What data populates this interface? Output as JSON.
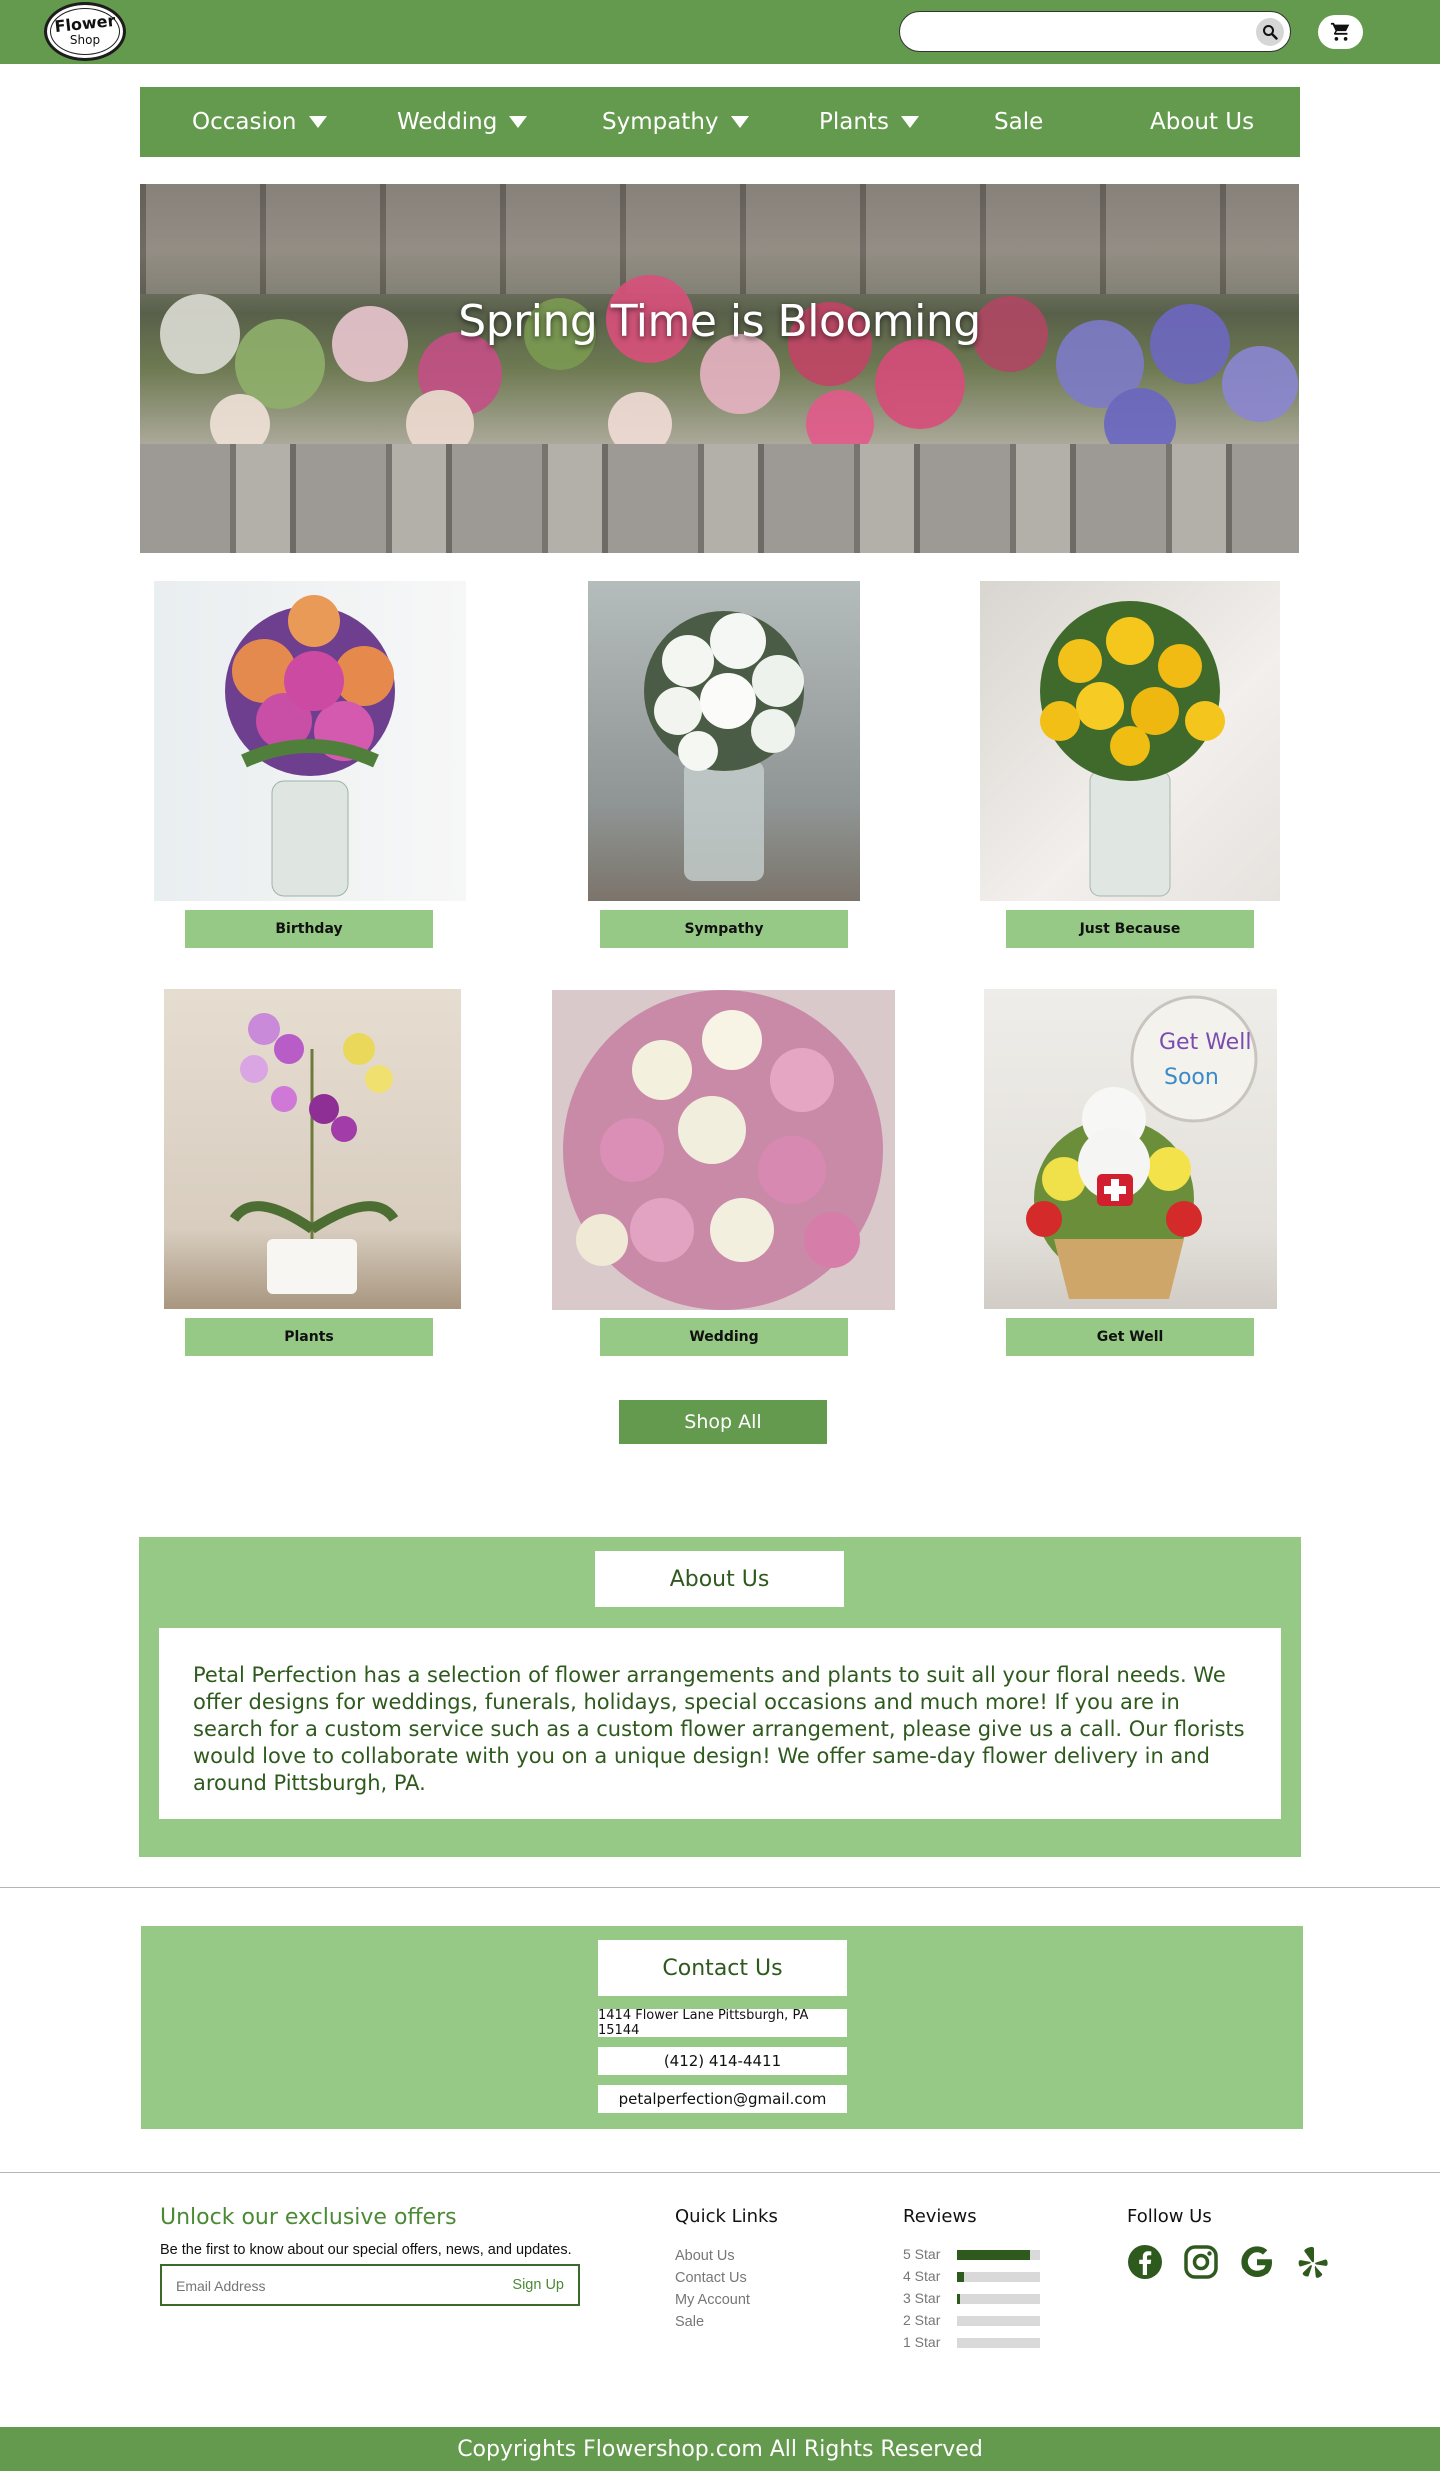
{
  "header": {
    "logo_line1": "Flower",
    "logo_line2": "Shop",
    "search_placeholder": "",
    "search_icon": "search-icon",
    "cart_icon": "cart-icon"
  },
  "nav": {
    "items": [
      {
        "label": "Occasion",
        "dropdown": true
      },
      {
        "label": "Wedding",
        "dropdown": true
      },
      {
        "label": "Sympathy",
        "dropdown": true
      },
      {
        "label": "Plants",
        "dropdown": true
      },
      {
        "label": "Sale",
        "dropdown": false
      },
      {
        "label": "About Us",
        "dropdown": false
      }
    ]
  },
  "hero": {
    "title": "Spring Time is Blooming"
  },
  "categories": [
    {
      "label": "Birthday"
    },
    {
      "label": "Sympathy"
    },
    {
      "label": "Just Because"
    },
    {
      "label": "Plants"
    },
    {
      "label": "Wedding"
    },
    {
      "label": "Get Well"
    }
  ],
  "shop_all": "Shop All",
  "about": {
    "title": "About Us",
    "body": "Petal Perfection has a selection of flower arrangements and plants to suit all your floral needs. We offer designs for weddings, funerals, holidays, special occasions and much more! If you are in search for a custom service such as a custom flower arrangement, please give us a call. Our florists  would love to collaborate with you on a unique design! We offer same-day flower delivery in and around Pittsburgh, PA."
  },
  "contact": {
    "title": "Contact Us",
    "address": "1414 Flower Lane Pittsburgh, PA 15144",
    "phone": "(412) 414-4411",
    "email": "petalperfection@gmail.com"
  },
  "footer": {
    "offers_title": "Unlock our exclusive offers",
    "offers_subtitle": "Be the first to know about our special offers, news, and updates.",
    "email_placeholder": "Email Address",
    "signup_label": "Sign Up",
    "quick_links_title": "Quick Links",
    "quick_links": [
      "About Us",
      "Contact Us",
      "My Account",
      "Sale"
    ],
    "reviews_title": "Reviews",
    "reviews": [
      {
        "label": "5 Star",
        "fraction": 0.88
      },
      {
        "label": "4 Star",
        "fraction": 0.08
      },
      {
        "label": "3 Star",
        "fraction": 0.04
      },
      {
        "label": "2 Star",
        "fraction": 0.0
      },
      {
        "label": "1 Star",
        "fraction": 0.0
      }
    ],
    "follow_title": "Follow Us",
    "social_icons": [
      "facebook-icon",
      "instagram-icon",
      "google-icon",
      "yelp-icon"
    ],
    "copyright": "Copyrights Flowershop.com All Rights Reserved"
  },
  "colors": {
    "primary_green": "#649a4d",
    "light_green": "#95c985",
    "dark_green": "#2e5a1e"
  }
}
